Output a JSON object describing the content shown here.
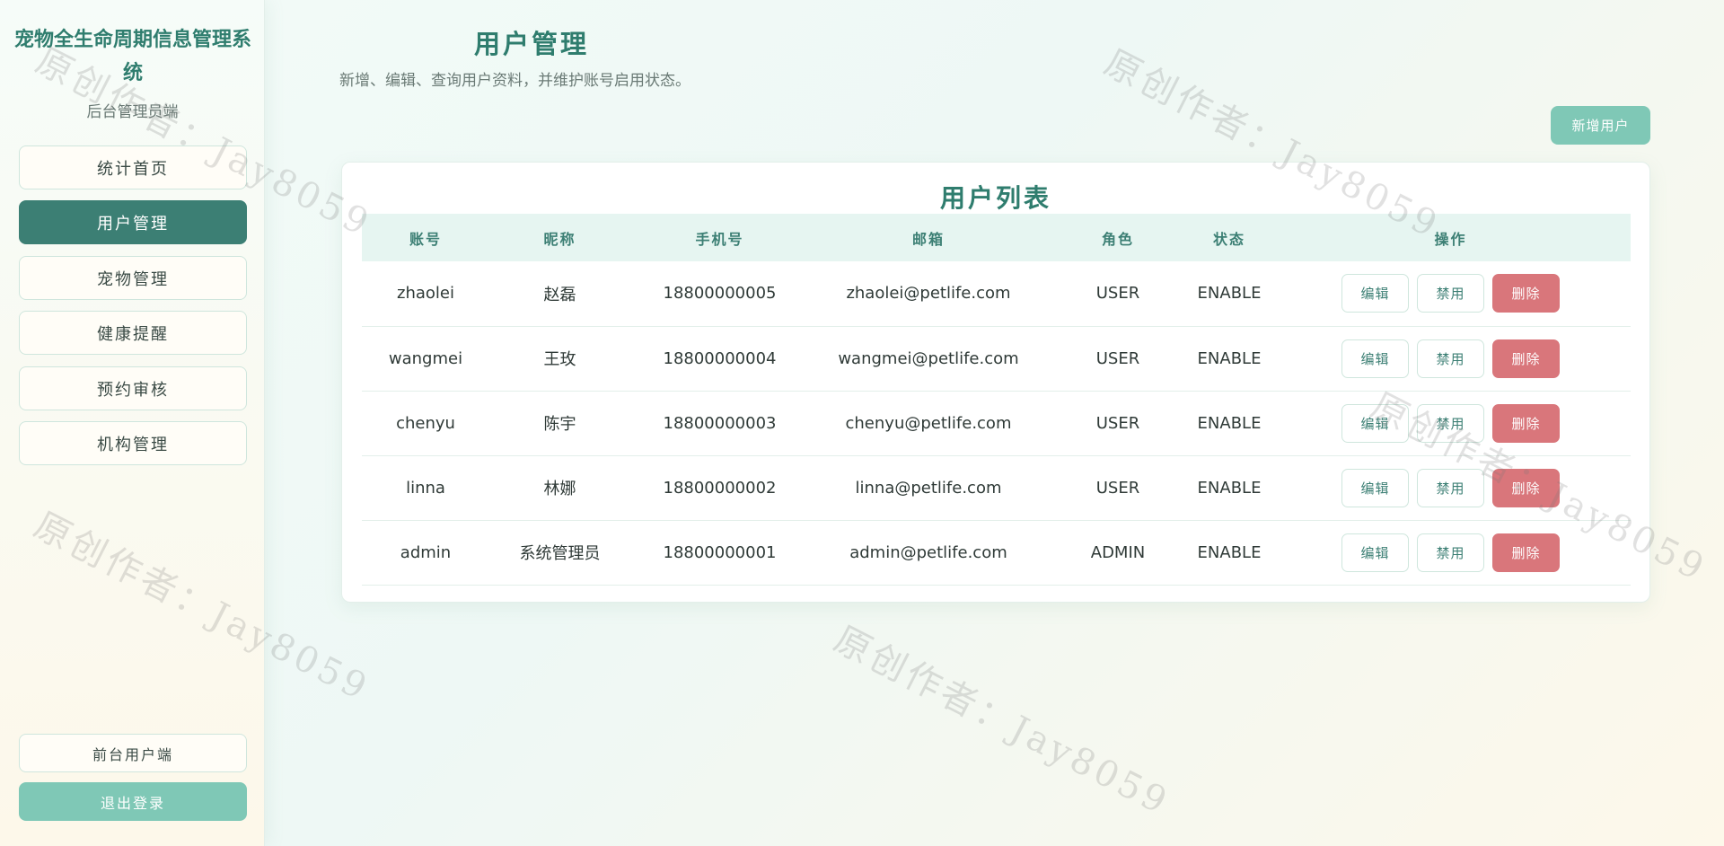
{
  "sidebar": {
    "title": "宠物全生命周期信息管理系统",
    "subtitle": "后台管理员端",
    "nav": [
      {
        "label": "统计首页",
        "active": false
      },
      {
        "label": "用户管理",
        "active": true
      },
      {
        "label": "宠物管理",
        "active": false
      },
      {
        "label": "健康提醒",
        "active": false
      },
      {
        "label": "预约审核",
        "active": false
      },
      {
        "label": "机构管理",
        "active": false
      }
    ],
    "front_label": "前台用户端",
    "logout_label": "退出登录"
  },
  "header": {
    "title": "用户管理",
    "description": "新增、编辑、查询用户资料，并维护账号启用状态。",
    "add_label": "新增用户"
  },
  "table": {
    "title": "用户列表",
    "columns": [
      "账号",
      "昵称",
      "手机号",
      "邮箱",
      "角色",
      "状态",
      "操作"
    ],
    "actions": {
      "edit": "编辑",
      "disable": "禁用",
      "delete": "删除"
    },
    "rows": [
      {
        "account": "zhaolei",
        "nickname": "赵磊",
        "phone": "18800000005",
        "email": "zhaolei@petlife.com",
        "role": "USER",
        "status": "ENABLE"
      },
      {
        "account": "wangmei",
        "nickname": "王玫",
        "phone": "18800000004",
        "email": "wangmei@petlife.com",
        "role": "USER",
        "status": "ENABLE"
      },
      {
        "account": "chenyu",
        "nickname": "陈宇",
        "phone": "18800000003",
        "email": "chenyu@petlife.com",
        "role": "USER",
        "status": "ENABLE"
      },
      {
        "account": "linna",
        "nickname": "林娜",
        "phone": "18800000002",
        "email": "linna@petlife.com",
        "role": "USER",
        "status": "ENABLE"
      },
      {
        "account": "admin",
        "nickname": "系统管理员",
        "phone": "18800000001",
        "email": "admin@petlife.com",
        "role": "ADMIN",
        "status": "ENABLE"
      }
    ]
  },
  "watermark": "原创作者：Jay8059",
  "colors": {
    "primary": "#3c7f74",
    "accent": "#7fc8b6",
    "danger": "#d9767b"
  }
}
